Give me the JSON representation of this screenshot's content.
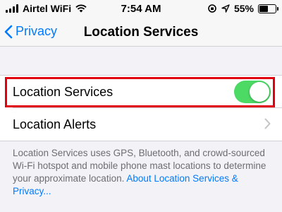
{
  "status_bar": {
    "carrier": "Airtel WiFi",
    "time": "7:54 AM",
    "battery_percent": "55%",
    "battery_level": 0.55
  },
  "nav": {
    "back_label": "Privacy",
    "title": "Location Services"
  },
  "settings": {
    "location_services": {
      "label": "Location Services",
      "enabled": true
    },
    "location_alerts": {
      "label": "Location Alerts"
    }
  },
  "footer": {
    "text": "Location Services uses GPS, Bluetooth, and crowd-sourced Wi-Fi hotspot and mobile phone mast locations to determine your approximate location.",
    "link": "About Location Services & Privacy..."
  },
  "colors": {
    "accent": "#007aff",
    "toggle_on": "#4cd964",
    "highlight": "#e0000f"
  }
}
